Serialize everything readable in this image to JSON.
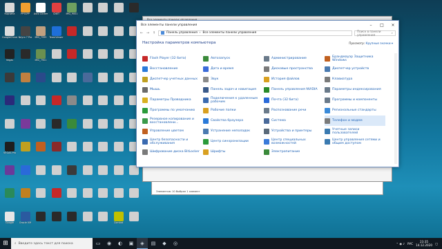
{
  "desktop": {
    "icons": [
      {
        "label": "Корзина",
        "color": "#d9d9d9"
      },
      {
        "label": "PPSSPP",
        "color": "#f0a030"
      },
      {
        "label": "Auto Clicker",
        "color": "#ffffff"
      },
      {
        "label": "CNET",
        "color": "#e04040"
      },
      {
        "label": "IMG_9001",
        "color": "#6fa060"
      },
      {
        "label": "",
        "color": "#d0d0d0"
      },
      {
        "label": "",
        "color": "#d0d0d0"
      },
      {
        "label": "",
        "color": "#d0d0d0"
      },
      {
        "label": "",
        "color": "#2a2a2a"
      },
      {
        "label": "GoogleChrome",
        "color": "#dcdcdc"
      },
      {
        "label": "Neyro 7 Pro",
        "color": "#444444"
      },
      {
        "label": "IMG_7999",
        "color": "#c0a080"
      },
      {
        "label": "TeamViewer",
        "color": "#1e6fd9"
      },
      {
        "label": "",
        "color": "#c62828"
      },
      {
        "label": "",
        "color": "#d0d0d0"
      },
      {
        "label": "",
        "color": "#d0d0d0"
      },
      {
        "label": "",
        "color": "#d0d0d0"
      },
      {
        "label": "",
        "color": "#d0d0d0"
      },
      {
        "label": "Vegas",
        "color": "#222222"
      },
      {
        "label": "",
        "color": "#2a2a2a"
      },
      {
        "label": "IMG_7901",
        "color": "#6a9050"
      },
      {
        "label": "",
        "color": "#d0d0d0"
      },
      {
        "label": "",
        "color": "#c62828"
      },
      {
        "label": "",
        "color": "#d0d0d0"
      },
      {
        "label": "",
        "color": "#d0d0d0"
      },
      {
        "label": "",
        "color": "#d0d0d0"
      },
      {
        "label": "",
        "color": "#d0d0d0"
      },
      {
        "label": "",
        "color": "#3a3a3a"
      },
      {
        "label": "",
        "color": "#c08040"
      },
      {
        "label": "",
        "color": "#2a4a8a"
      },
      {
        "label": "",
        "color": "#d0d0d0"
      },
      {
        "label": "",
        "color": "#d0d0d0"
      },
      {
        "label": "",
        "color": "#4a6a9a"
      },
      {
        "label": "",
        "color": "#d0d0d0"
      },
      {
        "label": "",
        "color": "#d0d0d0"
      },
      {
        "label": "",
        "color": "#d0d0d0"
      },
      {
        "label": "",
        "color": "#2a2a7a"
      },
      {
        "label": "",
        "color": "#d0d0d0"
      },
      {
        "label": "",
        "color": "#d0d0d0"
      },
      {
        "label": "",
        "color": "#c62828"
      },
      {
        "label": "",
        "color": "#8a8a8a"
      },
      {
        "label": "",
        "color": "#d0d0d0"
      },
      {
        "label": "",
        "color": "#d0d0d0"
      },
      {
        "label": "",
        "color": "#d0d0d0"
      },
      {
        "label": "",
        "color": "#d0d0d0"
      },
      {
        "label": "",
        "color": "#d0d0d0"
      },
      {
        "label": "",
        "color": "#7a3a9a"
      },
      {
        "label": "",
        "color": "#d0d0d0"
      },
      {
        "label": "",
        "color": "#2a2a2a"
      },
      {
        "label": "",
        "color": "#3a8a3a"
      },
      {
        "label": "",
        "color": "#d0d0d0"
      },
      {
        "label": "",
        "color": "#d0d0d0"
      },
      {
        "label": "",
        "color": "#d0d0d0"
      },
      {
        "label": "",
        "color": "#d0d0d0"
      },
      {
        "label": "VEGAS Pro",
        "color": "#1e1e1e"
      },
      {
        "label": "",
        "color": "#c0a020"
      },
      {
        "label": "",
        "color": "#c06020"
      },
      {
        "label": "",
        "color": "#8a2a2a"
      },
      {
        "label": "",
        "color": "#d0d0d0"
      },
      {
        "label": "",
        "color": "#d0d0d0"
      },
      {
        "label": "",
        "color": "#d0d0d0"
      },
      {
        "label": "",
        "color": "#d0d0d0"
      },
      {
        "label": "",
        "color": "#d0d0d0"
      },
      {
        "label": "",
        "color": "#6a3a9a"
      },
      {
        "label": "",
        "color": "#2a6ad9"
      },
      {
        "label": "",
        "color": "#d0d0d0"
      },
      {
        "label": "",
        "color": "#d0d0d0"
      },
      {
        "label": "",
        "color": "#3a3a3a"
      },
      {
        "label": "",
        "color": "#d0d0d0"
      },
      {
        "label": "",
        "color": "#d0d0d0"
      },
      {
        "label": "",
        "color": "#d0d0d0"
      },
      {
        "label": "",
        "color": "#d0d0d0"
      },
      {
        "label": "",
        "color": "#2a8a5a"
      },
      {
        "label": "",
        "color": "#c08020"
      },
      {
        "label": "",
        "color": "#d0d0d0"
      },
      {
        "label": "",
        "color": "#c62828"
      },
      {
        "label": "",
        "color": "#d0d0d0"
      },
      {
        "label": "",
        "color": "#d0d0d0"
      },
      {
        "label": "",
        "color": "#d0d0d0"
      },
      {
        "label": "",
        "color": "#d0d0d0"
      },
      {
        "label": "",
        "color": "#d0d0d0"
      },
      {
        "label": "Google",
        "color": "#e6e6e6"
      },
      {
        "label": "Oracle VM",
        "color": "#2a5aa0"
      },
      {
        "label": "",
        "color": "#2a2a2a"
      },
      {
        "label": "",
        "color": "#2a2a2a"
      },
      {
        "label": "",
        "color": "#2a2a2a"
      },
      {
        "label": "",
        "color": "#d0d0d0"
      },
      {
        "label": "",
        "color": "#d0d0d0"
      },
      {
        "label": "Combat",
        "color": "#c0c000"
      },
      {
        "label": "",
        "color": "#d0d0d0"
      }
    ]
  },
  "bg_window": {
    "rows": [
      "Новый том (E:)",
      "Новый том (E:)",
      "CD-дисковод (I:)"
    ],
    "status": "Элементов: 10     Выбран 1 элемент"
  },
  "mid_window": {
    "title": "Все элементы панели управления"
  },
  "control_panel": {
    "title": "Все элементы панели управления",
    "nav": [
      "←",
      "→",
      "↑"
    ],
    "breadcrumb": [
      "Панель управления",
      "Все элементы панели управления"
    ],
    "search_placeholder": "Поиск в панели управления",
    "heading": "Настройка параметров компьютера",
    "view_label": "Просмотр:",
    "view_value": "Крупные значки ▾",
    "items": [
      {
        "label": "Flash Player (32 бита)",
        "color": "#c62828"
      },
      {
        "label": "Автозапуск",
        "color": "#3a8a3a"
      },
      {
        "label": "Администрирование",
        "color": "#6a7a8a"
      },
      {
        "label": "Брандмауэр Защитника Windows",
        "color": "#c06020"
      },
      {
        "label": "Восстановление",
        "color": "#2a7ad9"
      },
      {
        "label": "Дата и время",
        "color": "#3a6ad9"
      },
      {
        "label": "Дисковые пространства",
        "color": "#7a7a7a"
      },
      {
        "label": "Диспетчер устройств",
        "color": "#4a7ab0"
      },
      {
        "label": "Диспетчер учетных данных",
        "color": "#c0a020"
      },
      {
        "label": "Звук",
        "color": "#8a8a8a"
      },
      {
        "label": "История файлов",
        "color": "#d9a020"
      },
      {
        "label": "Клавиатура",
        "color": "#7a7a7a"
      },
      {
        "label": "Мышь",
        "color": "#6a6a6a"
      },
      {
        "label": "Панель задач и навигация",
        "color": "#3a5a8a"
      },
      {
        "label": "Панель управления NVIDIA",
        "color": "#2a8a2a"
      },
      {
        "label": "Параметры индексирования",
        "color": "#6a7a8a"
      },
      {
        "label": "Параметры Проводника",
        "color": "#d9b020"
      },
      {
        "label": "Подключения к удаленным рабочим",
        "color": "#3a6ab0"
      },
      {
        "label": "Почта (32 бита)",
        "color": "#2a6ad9"
      },
      {
        "label": "Программы и компоненты",
        "color": "#6a7a8a"
      },
      {
        "label": "Программы по умолчанию",
        "color": "#2a9a3a"
      },
      {
        "label": "Рабочие папки",
        "color": "#d9a020"
      },
      {
        "label": "Распознавание речи",
        "color": "#6a7a8a"
      },
      {
        "label": "Региональные стандарты",
        "color": "#3a8ad9"
      },
      {
        "label": "Резервное копирование и восстановлени...",
        "color": "#3a9a4a"
      },
      {
        "label": "Свойства браузера",
        "color": "#2a7ad9"
      },
      {
        "label": "Система",
        "color": "#4a6a9a"
      },
      {
        "label": "Телефон и модем",
        "color": "#7a7a7a"
      },
      {
        "label": "Управление цветом",
        "color": "#c06020"
      },
      {
        "label": "Устранение неполадок",
        "color": "#4a7ab0"
      },
      {
        "label": "Устройства и принтеры",
        "color": "#5a6a7a"
      },
      {
        "label": "Учетные записи пользователей",
        "color": "#3a7ab0"
      },
      {
        "label": "Центр безопасности и обслуживания",
        "color": "#3a6ab0"
      },
      {
        "label": "Центр синхронизации",
        "color": "#2a9a3a"
      },
      {
        "label": "Центр специальных возможностей",
        "color": "#3a7ad9"
      },
      {
        "label": "Центр управления сетями и общим доступом",
        "color": "#3a7ab0"
      },
      {
        "label": "Шифрование диска BitLocker",
        "color": "#7a7a7a"
      },
      {
        "label": "Шрифты",
        "color": "#d9a020"
      },
      {
        "label": "Электропитание",
        "color": "#3a8a3a"
      }
    ],
    "highlighted_index": 27
  },
  "taskbar": {
    "search_placeholder": "Введите здесь текст для поиска",
    "apps": [
      "▭",
      "◉",
      "◐",
      "▣",
      "◈",
      "▤",
      "◆",
      "◎"
    ],
    "active_app_index": 4,
    "tray": {
      "lang": "РУС",
      "time": "23:35",
      "date": "14.12.2020"
    }
  }
}
